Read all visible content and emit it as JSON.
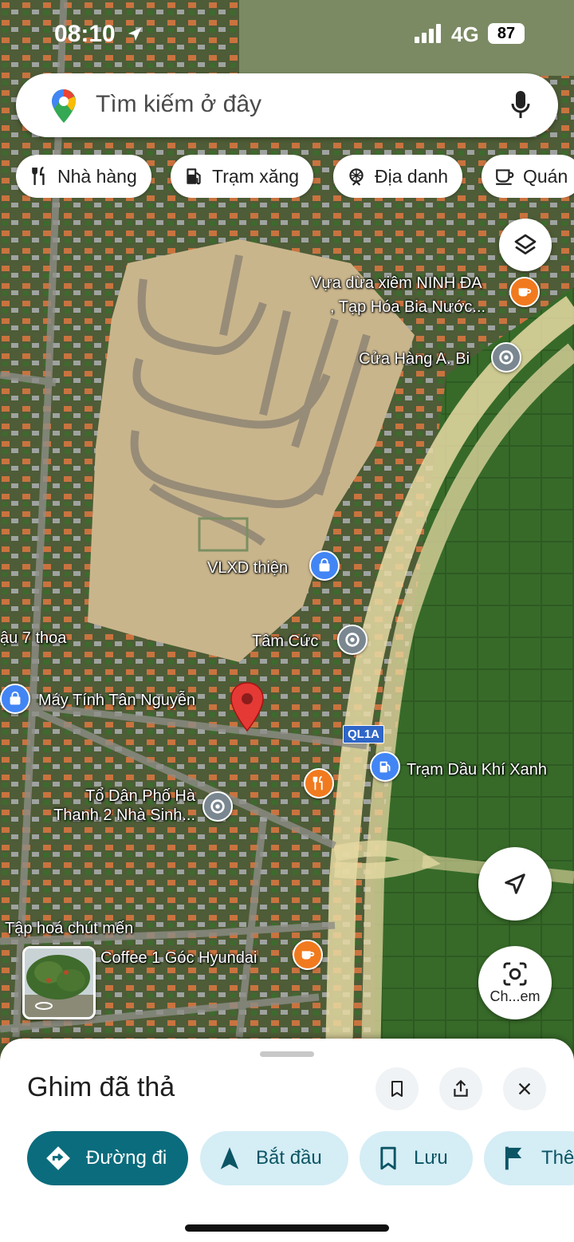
{
  "status_bar": {
    "time": "08:10",
    "network": "4G",
    "battery": "87"
  },
  "search": {
    "placeholder": "Tìm kiếm ở đây"
  },
  "chips": [
    {
      "label": "Nhà hàng",
      "icon": "restaurant-icon"
    },
    {
      "label": "Trạm xăng",
      "icon": "gas-station-icon"
    },
    {
      "label": "Địa danh",
      "icon": "landmark-icon"
    },
    {
      "label": "Quán",
      "icon": "cafe-icon"
    }
  ],
  "map": {
    "labels": {
      "vua_dua_line1": "Vựa dừa xiêm NINH ĐA",
      "vua_dua_line2": ", Tạp Hóa Bia Nước...",
      "cua_hang": "Cửa Hàng A. Bi",
      "vlxd": "VLXD thiện",
      "tam_cuc": "Tâm Cức",
      "dau_7_thoa": "ậu 7 thoa",
      "may_tinh": "Máy Tính Tân Nguyễn",
      "road_shield": "QL1A",
      "tram_dau": "Trạm Dầu Khí Xanh",
      "to_dan_pho_line1": "Tổ Dân Phố Hà",
      "to_dan_pho_line2": "Thanh 2 Nhà Sinh...",
      "tap_hoa": "Tập hoá chút mến",
      "coffee": "Coffee 1 Góc Hyundai"
    },
    "colors": {
      "poi_orange": "#f17a1e",
      "poi_blue": "#4285f4",
      "poi_gray": "#7a8790",
      "pin_red": "#e53935"
    }
  },
  "camera_button": {
    "label": "Ch...em"
  },
  "sheet": {
    "title": "Ghim đã thả",
    "actions": {
      "directions": "Đường đi",
      "start": "Bắt đầu",
      "save": "Lưu",
      "more": "Thê"
    }
  }
}
